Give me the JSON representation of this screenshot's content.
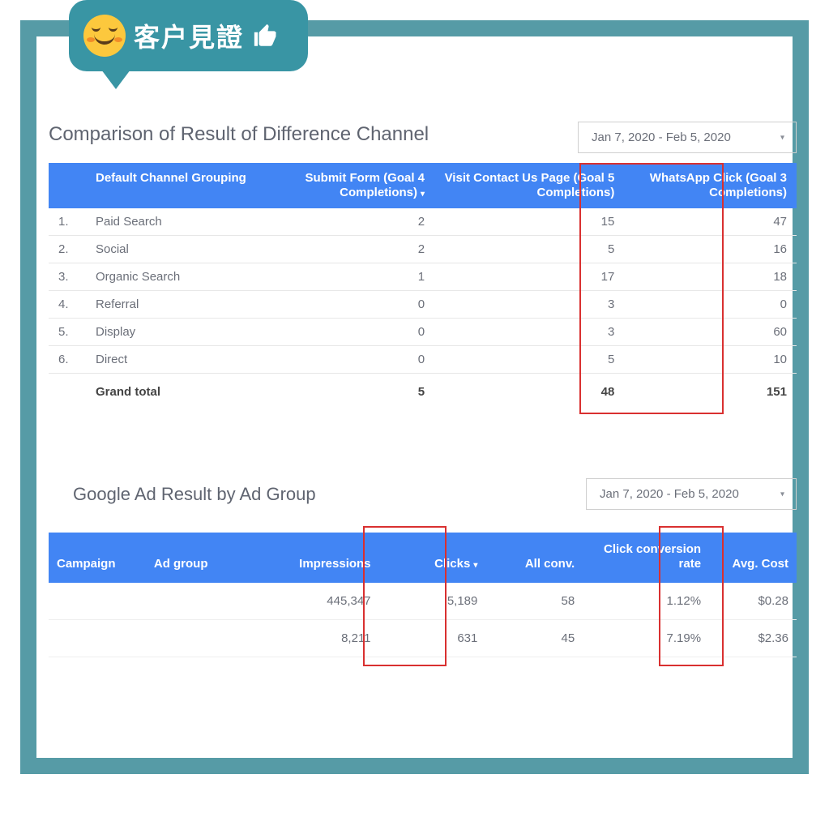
{
  "badge": {
    "text": "客户見證"
  },
  "section1": {
    "title": "Comparison of Result of Difference Channel",
    "date_range": "Jan 7, 2020 - Feb 5, 2020",
    "columns": {
      "channel": "Default Channel Grouping",
      "submit_form": "Submit Form (Goal 4 Completions)",
      "visit_contact": "Visit Contact Us Page (Goal 5 Completions)",
      "whatsapp": "WhatsApp Click (Goal 3 Completions)"
    },
    "rows": [
      {
        "idx": "1.",
        "channel": "Paid Search",
        "submit": "2",
        "visit": "15",
        "whatsapp": "47"
      },
      {
        "idx": "2.",
        "channel": "Social",
        "submit": "2",
        "visit": "5",
        "whatsapp": "16"
      },
      {
        "idx": "3.",
        "channel": "Organic Search",
        "submit": "1",
        "visit": "17",
        "whatsapp": "18"
      },
      {
        "idx": "4.",
        "channel": "Referral",
        "submit": "0",
        "visit": "3",
        "whatsapp": "0"
      },
      {
        "idx": "5.",
        "channel": "Display",
        "submit": "0",
        "visit": "3",
        "whatsapp": "60"
      },
      {
        "idx": "6.",
        "channel": "Direct",
        "submit": "0",
        "visit": "5",
        "whatsapp": "10"
      }
    ],
    "total": {
      "label": "Grand total",
      "submit": "5",
      "visit": "48",
      "whatsapp": "151"
    }
  },
  "section2": {
    "title": "Google Ad Result by Ad Group",
    "date_range": "Jan 7, 2020 - Feb 5, 2020",
    "columns": {
      "campaign": "Campaign",
      "adgroup": "Ad group",
      "impressions": "Impressions",
      "clicks": "Clicks",
      "allconv": "All conv.",
      "ccr": "Click conversion rate",
      "avgcost": "Avg. Cost"
    },
    "rows": [
      {
        "campaign": "",
        "adgroup": "",
        "impressions": "445,347",
        "clicks": "5,189",
        "allconv": "58",
        "ccr": "1.12%",
        "avgcost": "$0.28"
      },
      {
        "campaign": "",
        "adgroup": "",
        "impressions": "8,211",
        "clicks": "631",
        "allconv": "45",
        "ccr": "7.19%",
        "avgcost": "$2.36"
      }
    ]
  },
  "chart_data": [
    {
      "type": "table",
      "title": "Comparison of Result of Difference Channel",
      "date_range": "Jan 7, 2020 - Feb 5, 2020",
      "columns": [
        "Default Channel Grouping",
        "Submit Form (Goal 4 Completions)",
        "Visit Contact Us Page (Goal 5 Completions)",
        "WhatsApp Click (Goal 3 Completions)"
      ],
      "rows": [
        [
          "Paid Search",
          2,
          15,
          47
        ],
        [
          "Social",
          2,
          5,
          16
        ],
        [
          "Organic Search",
          1,
          17,
          18
        ],
        [
          "Referral",
          0,
          3,
          0
        ],
        [
          "Display",
          0,
          3,
          60
        ],
        [
          "Direct",
          0,
          5,
          10
        ]
      ],
      "totals": [
        "Grand total",
        5,
        48,
        151
      ]
    },
    {
      "type": "table",
      "title": "Google Ad Result by Ad Group",
      "date_range": "Jan 7, 2020 - Feb 5, 2020",
      "columns": [
        "Campaign",
        "Ad group",
        "Impressions",
        "Clicks",
        "All conv.",
        "Click conversion rate",
        "Avg. Cost"
      ],
      "rows": [
        [
          "",
          "",
          445347,
          5189,
          58,
          "1.12%",
          "$0.28"
        ],
        [
          "",
          "",
          8211,
          631,
          45,
          "7.19%",
          "$2.36"
        ]
      ]
    }
  ]
}
